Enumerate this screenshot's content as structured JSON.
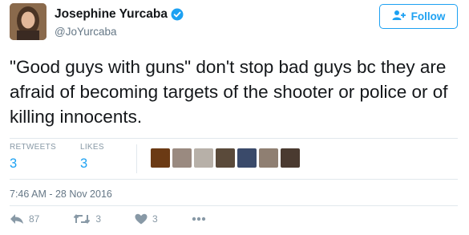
{
  "user": {
    "display_name": "Josephine Yurcaba",
    "handle": "@JoYurcaba",
    "verified": true
  },
  "follow_button": {
    "label": "Follow"
  },
  "tweet": {
    "text": "\"Good guys with guns\" don't stop bad guys bc they are afraid of becoming targets of the shooter or police or of killing innocents."
  },
  "stats": {
    "retweets_label": "RETWEETS",
    "retweets_value": "3",
    "likes_label": "LIKES",
    "likes_value": "3"
  },
  "likers": [
    {
      "name": "liker-avatar-1",
      "color": "#6b3a14"
    },
    {
      "name": "liker-avatar-2",
      "color": "#9a8a80"
    },
    {
      "name": "liker-avatar-3",
      "color": "#b7b0a8"
    },
    {
      "name": "liker-avatar-4",
      "color": "#5a4a3a"
    },
    {
      "name": "liker-avatar-5",
      "color": "#3a4a6a"
    },
    {
      "name": "liker-avatar-6",
      "color": "#8f7f72"
    },
    {
      "name": "liker-avatar-7",
      "color": "#4a3a30"
    }
  ],
  "timestamp": "7:46 AM - 28 Nov 2016",
  "actions": {
    "reply_count": "87",
    "retweet_count": "3",
    "like_count": "3"
  },
  "colors": {
    "accent": "#1da1f2",
    "muted": "#8899a6",
    "text": "#14171a"
  }
}
